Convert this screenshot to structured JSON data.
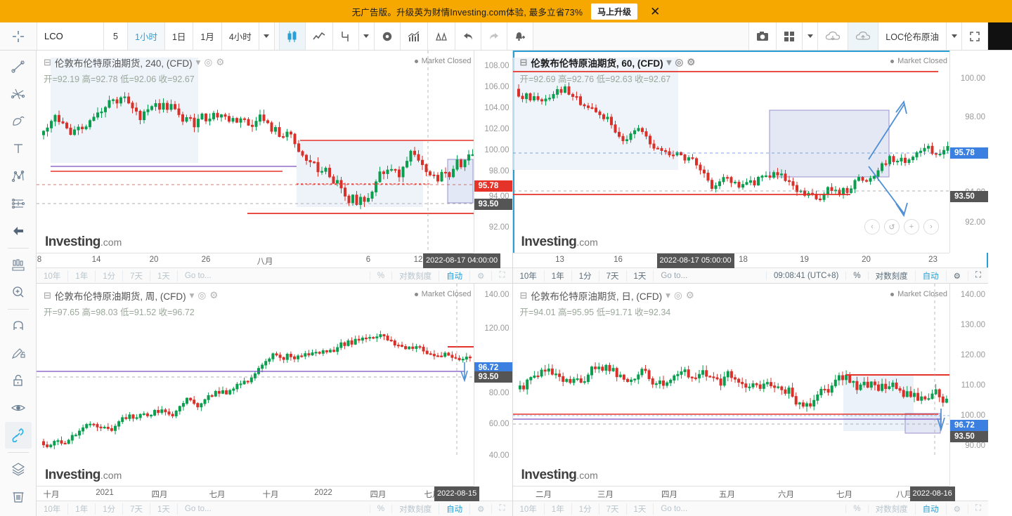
{
  "promo": {
    "text": "无广告版。升级英为财情Investing.com体验, 最多立省73%",
    "cta": "马上升级",
    "close": "✕"
  },
  "toolbar": {
    "symbol": "LCO",
    "interval_num": "5",
    "intervals": [
      "1小时",
      "1日",
      "1月",
      "4小时"
    ],
    "active_interval": "1小时",
    "more_caret": "▾",
    "icons": [
      "candlestick-chart-icon",
      "line-chart-icon",
      "indicators-icon",
      "settings-gear-icon",
      "compare-icon",
      "scales-icon",
      "undo-icon",
      "redo-icon",
      "alert-bell-icon"
    ],
    "right_icons": [
      "camera-icon",
      "layout-grid-icon",
      "cloud-download-icon",
      "cloud-upload-icon"
    ],
    "layout_name": "LOC伦布原油",
    "layout_caret": "▾",
    "fullscreen": "fullscreen-icon"
  },
  "sidebar": {
    "items": [
      {
        "name": "crosshair-cursor-icon"
      },
      {
        "name": "trend-line-icon"
      },
      {
        "name": "fib-fan-icon"
      },
      {
        "name": "pitchfork-icon"
      },
      {
        "name": "text-tool-icon"
      },
      {
        "name": "pattern-xabcd-icon"
      },
      {
        "name": "long-position-icon"
      },
      {
        "name": "arrow-left-icon"
      },
      {
        "name": "measure-icon"
      },
      {
        "name": "zoom-in-icon"
      },
      {
        "name": "magnet-icon"
      },
      {
        "name": "pencil-lock-icon"
      },
      {
        "name": "lock-icon"
      },
      {
        "name": "eye-icon"
      },
      {
        "name": "link-icon",
        "active": true
      },
      {
        "name": "layers-icon"
      },
      {
        "name": "trash-icon"
      }
    ]
  },
  "panels": [
    {
      "id": "panel-240",
      "title": "伦敦布伦特原油期货, 240, (CFD)",
      "ohlc": "开=92.19  高=92.78  低=92.06  收=92.67",
      "market_status": "Market Closed",
      "focused": false,
      "bold_title": false,
      "watermark_bold": "Investing",
      "watermark_small": ".com",
      "yticks": [
        "108.00",
        "106.00",
        "104.00",
        "102.00",
        "100.00",
        "98.00",
        "94.00",
        "92.00"
      ],
      "ybadges": [
        {
          "value": "95.78",
          "color": "red"
        },
        {
          "value": "93.50",
          "color": "grey"
        }
      ],
      "xticks": [
        "8",
        "14",
        "20",
        "26",
        "八月",
        "6",
        "12"
      ],
      "xbadge": "2022-08-17 04:00:00",
      "status": {
        "ranges": [
          "10年",
          "1年",
          "1分",
          "7天",
          "1天"
        ],
        "goto": "Go to...",
        "time": "",
        "percent": "%",
        "log": "对数刻度",
        "auto": "自动",
        "gear": "gear-icon",
        "expand": "expand-icon",
        "active": false
      }
    },
    {
      "id": "panel-60",
      "title": "伦敦布伦特原油期货, 60, (CFD)",
      "ohlc": "开=92.69  高=92.76  低=92.63  收=92.67",
      "market_status": "Market Closed",
      "focused": true,
      "bold_title": true,
      "watermark_bold": "Investing",
      "watermark_small": ".com",
      "yticks": [
        "100.00",
        "98.00",
        "94.00",
        "92.00"
      ],
      "ybadges": [
        {
          "value": "95.78",
          "color": "blue"
        },
        {
          "value": "93.50",
          "color": "grey"
        }
      ],
      "xticks": [
        "13",
        "16",
        "18",
        "19",
        "20",
        "23"
      ],
      "xbadge": "2022-08-17 05:00:00",
      "status": {
        "ranges": [
          "10年",
          "1年",
          "1分",
          "7天",
          "1天"
        ],
        "goto": "Go to...",
        "time": "09:08:41 (UTC+8)",
        "percent": "%",
        "log": "对数刻度",
        "auto": "自动",
        "gear": "gear-icon",
        "expand": "expand-icon",
        "active": true
      }
    },
    {
      "id": "panel-week",
      "title": "伦敦布伦特原油期货, 周, (CFD)",
      "ohlc": "开=97.65  高=98.03  低=91.52  收=96.72",
      "market_status": "Market Closed",
      "focused": false,
      "bold_title": false,
      "watermark_bold": "Investing",
      "watermark_small": ".com",
      "yticks": [
        "140.00",
        "120.00",
        "80.00",
        "60.00",
        "40.00"
      ],
      "ybadges": [
        {
          "value": "96.72",
          "color": "blue"
        },
        {
          "value": "93.50",
          "color": "grey"
        }
      ],
      "xticks": [
        "十月",
        "2021",
        "四月",
        "七月",
        "十月",
        "2022",
        "四月",
        "七月"
      ],
      "xbadge": "2022-08-15",
      "status": {
        "ranges": [
          "10年",
          "1年",
          "1分",
          "7天",
          "1天"
        ],
        "goto": "Go to...",
        "time": "",
        "percent": "%",
        "log": "对数刻度",
        "auto": "自动",
        "gear": "gear-icon",
        "expand": "expand-icon",
        "active": false
      }
    },
    {
      "id": "panel-day",
      "title": "伦敦布伦特原油期货, 日, (CFD)",
      "ohlc": "开=94.01  高=95.95  低=91.71  收=92.34",
      "market_status": "Market Closed",
      "focused": false,
      "bold_title": false,
      "watermark_bold": "Investing",
      "watermark_small": ".com",
      "yticks": [
        "140.00",
        "130.00",
        "120.00",
        "110.00",
        "100.00",
        "90.00"
      ],
      "ybadges": [
        {
          "value": "96.72",
          "color": "blue"
        },
        {
          "value": "93.50",
          "color": "grey"
        }
      ],
      "xticks": [
        "二月",
        "三月",
        "四月",
        "五月",
        "六月",
        "七月",
        "八月"
      ],
      "xbadge": "2022-08-16",
      "status": {
        "ranges": [
          "10年",
          "1年",
          "1分",
          "7天",
          "1天"
        ],
        "goto": "Go to...",
        "time": "",
        "percent": "%",
        "log": "对数刻度",
        "auto": "自动",
        "gear": "gear-icon",
        "expand": "expand-icon",
        "active": false
      }
    }
  ],
  "colors": {
    "promo": "#f7a800",
    "accent": "#2a9fd6",
    "up": "#0a9e4e",
    "down": "#d8312a",
    "resistance_line": "#e5332a",
    "focus_border": "#2a9fd6"
  },
  "chart_data": [
    {
      "type": "candlestick",
      "title": "伦敦布伦特原油期货, 240, (CFD)",
      "ylim": [
        91.0,
        109.0
      ],
      "ytick_values": [
        108,
        106,
        104,
        102,
        100,
        98,
        94,
        92
      ],
      "xlabel": "",
      "ylabel": "",
      "grid": false,
      "annotations": [
        {
          "type": "hline",
          "value": 100.0,
          "color": "#e5332a"
        },
        {
          "type": "hline",
          "value": 97.3,
          "color": "#7a4fc0"
        },
        {
          "type": "hline",
          "value": 97.0,
          "color": "#e5332a"
        },
        {
          "type": "hline",
          "value": 95.78,
          "color": "#e5332a",
          "dashed": true
        },
        {
          "type": "hline",
          "value": 93.5,
          "color": "#777",
          "dashed": true
        },
        {
          "type": "hline",
          "value": 92.2,
          "color": "#e5332a"
        },
        {
          "type": "rect",
          "label": "range-box"
        },
        {
          "type": "arrow",
          "direction": "up"
        },
        {
          "type": "arrow",
          "direction": "down"
        }
      ],
      "last_price": 95.78,
      "secondary_price": 93.5
    },
    {
      "type": "candlestick",
      "title": "伦敦布伦特原油期货, 60, (CFD)",
      "ylim": [
        91.0,
        101.5
      ],
      "ytick_values": [
        100,
        98,
        94,
        92
      ],
      "grid": false,
      "annotations": [
        {
          "type": "hline",
          "value": 100.3,
          "color": "#e5332a"
        },
        {
          "type": "hline",
          "value": 95.78,
          "color": "#3b7fe0",
          "dashed": true
        },
        {
          "type": "hline",
          "value": 93.5,
          "color": "#777",
          "dashed": true
        },
        {
          "type": "hline",
          "value": 93.1,
          "color": "#e5332a"
        },
        {
          "type": "rect",
          "label": "range-box"
        },
        {
          "type": "arrow",
          "direction": "up"
        },
        {
          "type": "arrow",
          "direction": "down"
        }
      ],
      "last_price": 95.78,
      "secondary_price": 93.5
    },
    {
      "type": "candlestick",
      "title": "伦敦布伦特原油期货, 周, (CFD)",
      "ylim": [
        30,
        145
      ],
      "ytick_values": [
        140,
        120,
        80,
        60,
        40
      ],
      "grid": false,
      "annotations": [
        {
          "type": "hline",
          "value": 108,
          "color": "#e5332a"
        },
        {
          "type": "hline",
          "value": 96.72,
          "color": "#7a4fc0"
        },
        {
          "type": "hline",
          "value": 93.5,
          "color": "#777",
          "dashed": true
        },
        {
          "type": "arrow",
          "direction": "down"
        }
      ],
      "last_price": 96.72,
      "secondary_price": 93.5
    },
    {
      "type": "candlestick",
      "title": "伦敦布伦特原油期货, 日, (CFD)",
      "ylim": [
        86,
        146
      ],
      "ytick_values": [
        140,
        130,
        120,
        110,
        100,
        90
      ],
      "grid": false,
      "annotations": [
        {
          "type": "hline",
          "value": 110,
          "color": "#e5332a"
        },
        {
          "type": "hline",
          "value": 99.5,
          "color": "#e5332a"
        },
        {
          "type": "hline",
          "value": 96.72,
          "color": "#7a4fc0"
        },
        {
          "type": "hline",
          "value": 93.5,
          "color": "#777",
          "dashed": true
        },
        {
          "type": "rect",
          "label": "range-box"
        },
        {
          "type": "arrow",
          "direction": "down"
        }
      ],
      "last_price": 96.72,
      "secondary_price": 93.5
    }
  ]
}
